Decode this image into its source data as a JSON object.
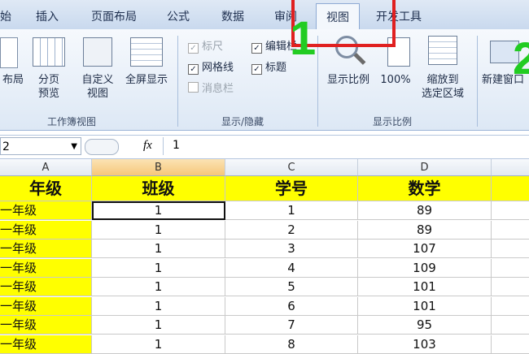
{
  "tabs": [
    "始",
    "插入",
    "页面布局",
    "公式",
    "数据",
    "审阅",
    "视图",
    "开发工具"
  ],
  "ribbon": {
    "workbook_views": {
      "label": "工作簿视图",
      "buttons": [
        "布局",
        "分页\n预览",
        "自定义\n视图",
        "全屏显示"
      ]
    },
    "show_hide": {
      "label": "显示/隐藏",
      "checkboxes": [
        {
          "label": "标尺",
          "checked": true,
          "disabled": true
        },
        {
          "label": "编辑栏",
          "checked": true,
          "disabled": false
        },
        {
          "label": "网格线",
          "checked": true,
          "disabled": false
        },
        {
          "label": "标题",
          "checked": true,
          "disabled": false
        },
        {
          "label": "消息栏",
          "checked": false,
          "disabled": true
        }
      ]
    },
    "zoom": {
      "label": "显示比例",
      "buttons": [
        "显示比例",
        "100%",
        "缩放到\n选定区域"
      ]
    },
    "window": {
      "buttons": [
        "新建窗口"
      ]
    }
  },
  "annotations": {
    "box_number": "1",
    "second_number": "2"
  },
  "formula_bar": {
    "name_box": "2",
    "fx": "fx",
    "value": "1"
  },
  "columns": [
    "A",
    "B",
    "C",
    "D"
  ],
  "header_row": [
    "年级",
    "班级",
    "学号",
    "数学"
  ],
  "rows": [
    [
      "一年级",
      "1",
      "1",
      "89"
    ],
    [
      "一年级",
      "1",
      "2",
      "89"
    ],
    [
      "一年级",
      "1",
      "3",
      "107"
    ],
    [
      "一年级",
      "1",
      "4",
      "109"
    ],
    [
      "一年级",
      "1",
      "5",
      "101"
    ],
    [
      "一年级",
      "1",
      "6",
      "101"
    ],
    [
      "一年级",
      "1",
      "7",
      "95"
    ],
    [
      "一年级",
      "1",
      "8",
      "103"
    ]
  ],
  "colors": {
    "highlight": "#ffff00",
    "annotation_red": "#e02020",
    "annotation_green": "#22cc22"
  }
}
